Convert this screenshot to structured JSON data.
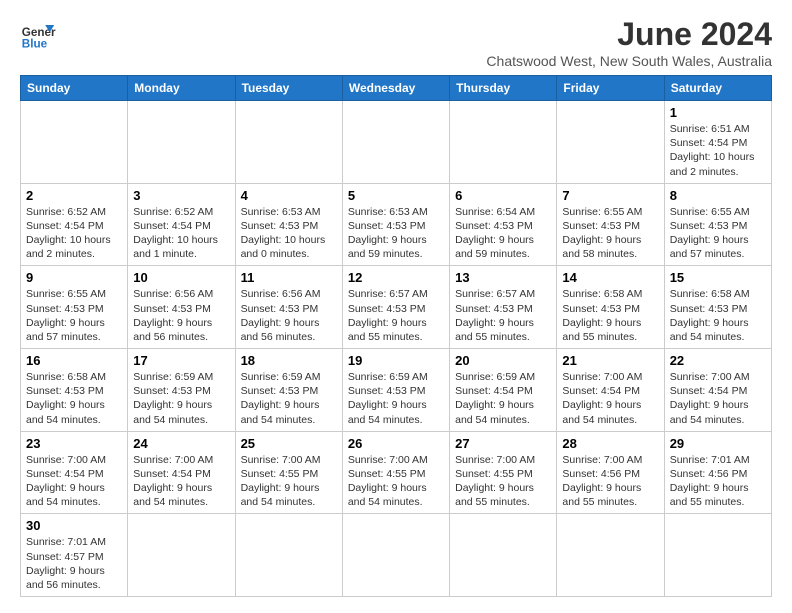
{
  "header": {
    "logo_general": "General",
    "logo_blue": "Blue",
    "title": "June 2024",
    "subtitle": "Chatswood West, New South Wales, Australia"
  },
  "weekdays": [
    "Sunday",
    "Monday",
    "Tuesday",
    "Wednesday",
    "Thursday",
    "Friday",
    "Saturday"
  ],
  "weeks": [
    [
      {
        "day": null,
        "info": null
      },
      {
        "day": null,
        "info": null
      },
      {
        "day": null,
        "info": null
      },
      {
        "day": null,
        "info": null
      },
      {
        "day": null,
        "info": null
      },
      {
        "day": null,
        "info": null
      },
      {
        "day": "1",
        "info": "Sunrise: 6:51 AM\nSunset: 4:54 PM\nDaylight: 10 hours and 2 minutes."
      }
    ],
    [
      {
        "day": "2",
        "info": "Sunrise: 6:52 AM\nSunset: 4:54 PM\nDaylight: 10 hours and 2 minutes."
      },
      {
        "day": "3",
        "info": "Sunrise: 6:52 AM\nSunset: 4:54 PM\nDaylight: 10 hours and 1 minute."
      },
      {
        "day": "4",
        "info": "Sunrise: 6:53 AM\nSunset: 4:53 PM\nDaylight: 10 hours and 0 minutes."
      },
      {
        "day": "5",
        "info": "Sunrise: 6:53 AM\nSunset: 4:53 PM\nDaylight: 9 hours and 59 minutes."
      },
      {
        "day": "6",
        "info": "Sunrise: 6:54 AM\nSunset: 4:53 PM\nDaylight: 9 hours and 59 minutes."
      },
      {
        "day": "7",
        "info": "Sunrise: 6:55 AM\nSunset: 4:53 PM\nDaylight: 9 hours and 58 minutes."
      },
      {
        "day": "8",
        "info": "Sunrise: 6:55 AM\nSunset: 4:53 PM\nDaylight: 9 hours and 57 minutes."
      }
    ],
    [
      {
        "day": "9",
        "info": "Sunrise: 6:55 AM\nSunset: 4:53 PM\nDaylight: 9 hours and 57 minutes."
      },
      {
        "day": "10",
        "info": "Sunrise: 6:56 AM\nSunset: 4:53 PM\nDaylight: 9 hours and 56 minutes."
      },
      {
        "day": "11",
        "info": "Sunrise: 6:56 AM\nSunset: 4:53 PM\nDaylight: 9 hours and 56 minutes."
      },
      {
        "day": "12",
        "info": "Sunrise: 6:57 AM\nSunset: 4:53 PM\nDaylight: 9 hours and 55 minutes."
      },
      {
        "day": "13",
        "info": "Sunrise: 6:57 AM\nSunset: 4:53 PM\nDaylight: 9 hours and 55 minutes."
      },
      {
        "day": "14",
        "info": "Sunrise: 6:58 AM\nSunset: 4:53 PM\nDaylight: 9 hours and 55 minutes."
      },
      {
        "day": "15",
        "info": "Sunrise: 6:58 AM\nSunset: 4:53 PM\nDaylight: 9 hours and 54 minutes."
      }
    ],
    [
      {
        "day": "16",
        "info": "Sunrise: 6:58 AM\nSunset: 4:53 PM\nDaylight: 9 hours and 54 minutes."
      },
      {
        "day": "17",
        "info": "Sunrise: 6:59 AM\nSunset: 4:53 PM\nDaylight: 9 hours and 54 minutes."
      },
      {
        "day": "18",
        "info": "Sunrise: 6:59 AM\nSunset: 4:53 PM\nDaylight: 9 hours and 54 minutes."
      },
      {
        "day": "19",
        "info": "Sunrise: 6:59 AM\nSunset: 4:53 PM\nDaylight: 9 hours and 54 minutes."
      },
      {
        "day": "20",
        "info": "Sunrise: 6:59 AM\nSunset: 4:54 PM\nDaylight: 9 hours and 54 minutes."
      },
      {
        "day": "21",
        "info": "Sunrise: 7:00 AM\nSunset: 4:54 PM\nDaylight: 9 hours and 54 minutes."
      },
      {
        "day": "22",
        "info": "Sunrise: 7:00 AM\nSunset: 4:54 PM\nDaylight: 9 hours and 54 minutes."
      }
    ],
    [
      {
        "day": "23",
        "info": "Sunrise: 7:00 AM\nSunset: 4:54 PM\nDaylight: 9 hours and 54 minutes."
      },
      {
        "day": "24",
        "info": "Sunrise: 7:00 AM\nSunset: 4:54 PM\nDaylight: 9 hours and 54 minutes."
      },
      {
        "day": "25",
        "info": "Sunrise: 7:00 AM\nSunset: 4:55 PM\nDaylight: 9 hours and 54 minutes."
      },
      {
        "day": "26",
        "info": "Sunrise: 7:00 AM\nSunset: 4:55 PM\nDaylight: 9 hours and 54 minutes."
      },
      {
        "day": "27",
        "info": "Sunrise: 7:00 AM\nSunset: 4:55 PM\nDaylight: 9 hours and 55 minutes."
      },
      {
        "day": "28",
        "info": "Sunrise: 7:00 AM\nSunset: 4:56 PM\nDaylight: 9 hours and 55 minutes."
      },
      {
        "day": "29",
        "info": "Sunrise: 7:01 AM\nSunset: 4:56 PM\nDaylight: 9 hours and 55 minutes."
      }
    ],
    [
      {
        "day": "30",
        "info": "Sunrise: 7:01 AM\nSunset: 4:57 PM\nDaylight: 9 hours and 56 minutes."
      },
      {
        "day": null,
        "info": null
      },
      {
        "day": null,
        "info": null
      },
      {
        "day": null,
        "info": null
      },
      {
        "day": null,
        "info": null
      },
      {
        "day": null,
        "info": null
      },
      {
        "day": null,
        "info": null
      }
    ]
  ]
}
